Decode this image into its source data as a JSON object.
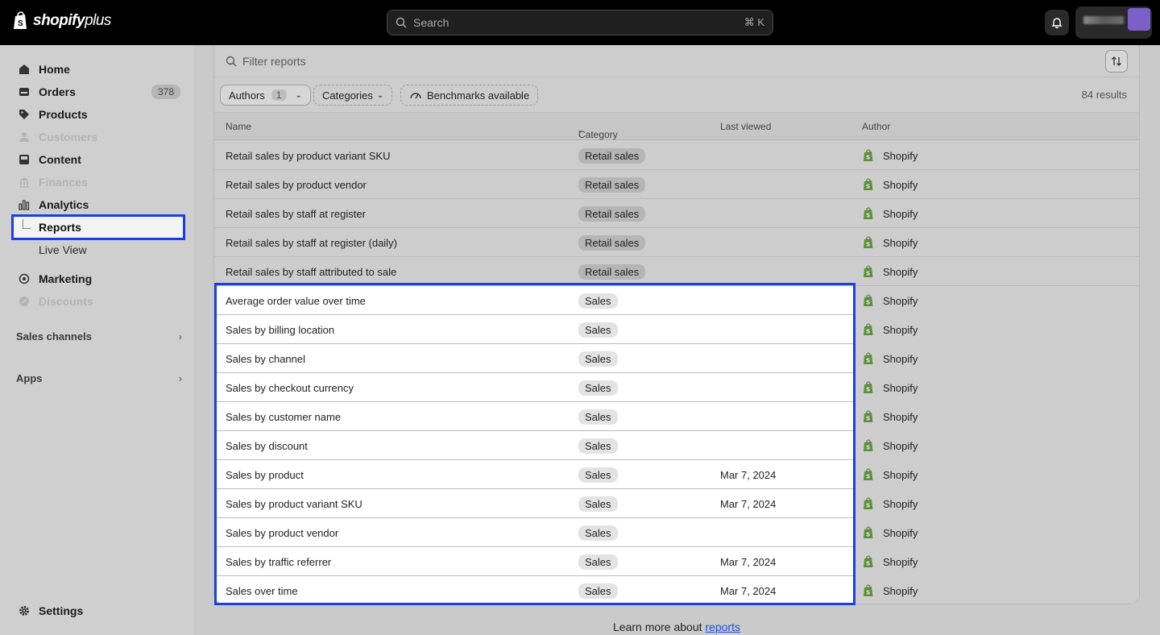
{
  "app": {
    "logo_text": "shopify",
    "logo_plus": "plus"
  },
  "search": {
    "placeholder": "Search",
    "shortcut": "⌘ K"
  },
  "sidebar": {
    "items": [
      {
        "label": "Home",
        "icon": "home-icon"
      },
      {
        "label": "Orders",
        "icon": "orders-icon",
        "count": "378"
      },
      {
        "label": "Products",
        "icon": "tag-icon"
      },
      {
        "label": "Customers",
        "icon": "person-icon"
      },
      {
        "label": "Content",
        "icon": "content-icon"
      },
      {
        "label": "Finances",
        "icon": "bank-icon"
      },
      {
        "label": "Analytics",
        "icon": "bar-chart-icon"
      },
      {
        "label": "Reports"
      },
      {
        "label": "Live View"
      },
      {
        "label": "Marketing",
        "icon": "target-icon"
      },
      {
        "label": "Discounts",
        "icon": "discount-icon"
      }
    ],
    "sections": {
      "sales_channels": "Sales channels",
      "apps": "Apps"
    },
    "settings": "Settings"
  },
  "filters": {
    "placeholder": "Filter reports",
    "authors_label": "Authors",
    "authors_count": "1",
    "categories_label": "Categories",
    "benchmarks_label": "Benchmarks available",
    "results": "84 results"
  },
  "table": {
    "headers": {
      "name": "Name",
      "category": "Category",
      "last_viewed": "Last viewed",
      "author": "Author"
    },
    "rows": [
      {
        "name": "Retail sales by product variant SKU",
        "category": "Retail sales",
        "last_viewed": "",
        "author": "Shopify"
      },
      {
        "name": "Retail sales by product vendor",
        "category": "Retail sales",
        "last_viewed": "",
        "author": "Shopify"
      },
      {
        "name": "Retail sales by staff at register",
        "category": "Retail sales",
        "last_viewed": "",
        "author": "Shopify"
      },
      {
        "name": "Retail sales by staff at register (daily)",
        "category": "Retail sales",
        "last_viewed": "",
        "author": "Shopify"
      },
      {
        "name": "Retail sales by staff attributed to sale",
        "category": "Retail sales",
        "last_viewed": "",
        "author": "Shopify"
      },
      {
        "name": "Average order value over time",
        "category": "Sales",
        "last_viewed": "",
        "author": "Shopify"
      },
      {
        "name": "Sales by billing location",
        "category": "Sales",
        "last_viewed": "",
        "author": "Shopify"
      },
      {
        "name": "Sales by channel",
        "category": "Sales",
        "last_viewed": "",
        "author": "Shopify"
      },
      {
        "name": "Sales by checkout currency",
        "category": "Sales",
        "last_viewed": "",
        "author": "Shopify"
      },
      {
        "name": "Sales by customer name",
        "category": "Sales",
        "last_viewed": "",
        "author": "Shopify"
      },
      {
        "name": "Sales by discount",
        "category": "Sales",
        "last_viewed": "",
        "author": "Shopify"
      },
      {
        "name": "Sales by product",
        "category": "Sales",
        "last_viewed": "Mar 7, 2024",
        "author": "Shopify"
      },
      {
        "name": "Sales by product variant SKU",
        "category": "Sales",
        "last_viewed": "Mar 7, 2024",
        "author": "Shopify"
      },
      {
        "name": "Sales by product vendor",
        "category": "Sales",
        "last_viewed": "",
        "author": "Shopify"
      },
      {
        "name": "Sales by traffic referrer",
        "category": "Sales",
        "last_viewed": "Mar 7, 2024",
        "author": "Shopify"
      },
      {
        "name": "Sales over time",
        "category": "Sales",
        "last_viewed": "Mar 7, 2024",
        "author": "Shopify"
      }
    ]
  },
  "footer": {
    "text": "Learn more about ",
    "link": "reports"
  },
  "colors": {
    "highlight": "#1a3ee8",
    "shopify_green": "#5e8e3e"
  }
}
